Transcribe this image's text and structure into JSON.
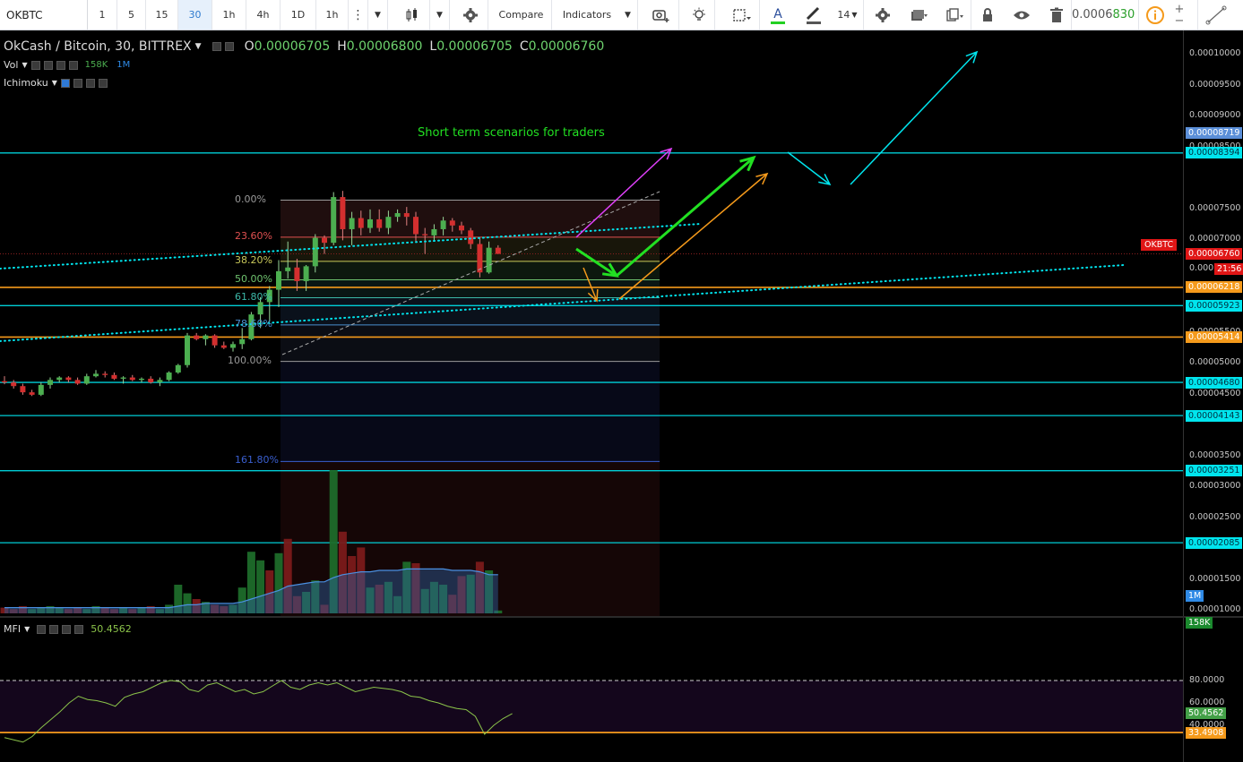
{
  "toolbar": {
    "symbol": "OKBTC",
    "intervals": [
      "1",
      "5",
      "15",
      "30",
      "1h",
      "4h",
      "1D",
      "1h"
    ],
    "active_interval": "30",
    "compare_label": "Compare",
    "indicators_label": "Indicators",
    "font_size": "14",
    "price_peek_a": "0.0006",
    "price_peek_b": "830"
  },
  "legend": {
    "title": "OkCash / Bitcoin, 30, BITTREX",
    "o_label": "O",
    "o": "0.00006705",
    "h_label": "H",
    "h": "0.00006800",
    "l_label": "L",
    "l": "0.00006705",
    "c_label": "C",
    "c": "0.00006760",
    "vol_label": "Vol",
    "vol_value": "158K",
    "vol_ma": "1M",
    "ichimoku_label": "Ichimoku",
    "mfi_label": "MFI",
    "mfi_value": "50.4562"
  },
  "annotation": {
    "text": "Short term scenarios for traders"
  },
  "fib_levels": [
    {
      "label": "0.00%",
      "color": "#9a9a9a"
    },
    {
      "label": "23.60%",
      "color": "#e05050"
    },
    {
      "label": "38.20%",
      "color": "#c9c95a"
    },
    {
      "label": "50.00%",
      "color": "#6fc36f"
    },
    {
      "label": "61.80%",
      "color": "#3cb8a8"
    },
    {
      "label": "78.60%",
      "color": "#4a8fd0"
    },
    {
      "label": "100.00%",
      "color": "#9a9a9a"
    },
    {
      "label": "161.80%",
      "color": "#3a5fd0"
    }
  ],
  "price_axis": {
    "ticks": [
      "0.00010000",
      "0.00009500",
      "0.00009000",
      "0.00008500",
      "0.00007500",
      "0.00007000",
      "0.000",
      "0.00005500",
      "0.00005000",
      "0.00004500",
      "0.00003500",
      "0.00003000",
      "0.00002500",
      "0.00001500",
      "0.00001000"
    ],
    "labels": [
      {
        "text": "0.00008719",
        "bg": "#5b8fd8",
        "fg": "#ffffff"
      },
      {
        "text": "0.00008394",
        "bg": "#00e5ee",
        "fg": "#003040"
      },
      {
        "text": "0.00006760",
        "bg": "#e01616",
        "fg": "#ffffff"
      },
      {
        "text": "21:56",
        "bg": "#e01616",
        "fg": "#ffffff"
      },
      {
        "text": "0.00006218",
        "bg": "#f59a1b",
        "fg": "#ffffff"
      },
      {
        "text": "0.00005923",
        "bg": "#00e5ee",
        "fg": "#003040"
      },
      {
        "text": "0.00005414",
        "bg": "#f59a1b",
        "fg": "#ffffff"
      },
      {
        "text": "0.00004680",
        "bg": "#00e5ee",
        "fg": "#003040"
      },
      {
        "text": "0.00004143",
        "bg": "#00e5ee",
        "fg": "#003040"
      },
      {
        "text": "0.00003251",
        "bg": "#00e5ee",
        "fg": "#003040"
      },
      {
        "text": "0.00002085",
        "bg": "#00e5ee",
        "fg": "#003040"
      },
      {
        "text": "1M",
        "bg": "#2f8ae6",
        "fg": "#ffffff"
      },
      {
        "text": "158K",
        "bg": "#1b8a2e",
        "fg": "#ffffff"
      }
    ],
    "symbol_badge": "OKBTC"
  },
  "mfi_axis": {
    "ticks": [
      "80.0000",
      "60.0000",
      "40.0000"
    ],
    "labels": [
      {
        "text": "50.4562",
        "bg": "#43a047",
        "fg": "#ffffff"
      },
      {
        "text": "33.4908",
        "bg": "#f59a1b",
        "fg": "#ffffff"
      }
    ]
  },
  "colors": {
    "up": "#4caf50",
    "down": "#d32f2f",
    "cyan": "#00e5ee",
    "orange": "#f59a1b",
    "magenta": "#e040fb",
    "green_arrow": "#22e022",
    "mfi_bg": "#14061c"
  },
  "candles": [
    [
      4.7e-05,
      4.78e-05,
      4.65e-05,
      4.68e-05
    ],
    [
      4.68e-05,
      4.72e-05,
      4.58e-05,
      4.62e-05
    ],
    [
      4.62e-05,
      4.66e-05,
      4.48e-05,
      4.52e-05
    ],
    [
      4.52e-05,
      4.56e-05,
      4.46e-05,
      4.48e-05
    ],
    [
      4.48e-05,
      4.68e-05,
      4.46e-05,
      4.64e-05
    ],
    [
      4.64e-05,
      4.76e-05,
      4.58e-05,
      4.72e-05
    ],
    [
      4.72e-05,
      4.78e-05,
      4.68e-05,
      4.76e-05
    ],
    [
      4.76e-05,
      4.78e-05,
      4.68e-05,
      4.72e-05
    ],
    [
      4.72e-05,
      4.76e-05,
      4.64e-05,
      4.66e-05
    ],
    [
      4.66e-05,
      4.82e-05,
      4.64e-05,
      4.78e-05
    ],
    [
      4.78e-05,
      4.88e-05,
      4.76e-05,
      4.82e-05
    ],
    [
      4.82e-05,
      4.86e-05,
      4.76e-05,
      4.8e-05
    ],
    [
      4.8e-05,
      4.84e-05,
      4.72e-05,
      4.74e-05
    ],
    [
      4.74e-05,
      4.78e-05,
      4.66e-05,
      4.76e-05
    ],
    [
      4.76e-05,
      4.8e-05,
      4.7e-05,
      4.72e-05
    ],
    [
      4.72e-05,
      4.76e-05,
      4.68e-05,
      4.74e-05
    ],
    [
      4.74e-05,
      4.78e-05,
      4.66e-05,
      4.68e-05
    ],
    [
      4.68e-05,
      4.76e-05,
      4.62e-05,
      4.72e-05
    ],
    [
      4.72e-05,
      4.86e-05,
      4.7e-05,
      4.84e-05
    ],
    [
      4.84e-05,
      4.98e-05,
      4.82e-05,
      4.96e-05
    ],
    [
      4.96e-05,
      5.48e-05,
      4.92e-05,
      5.44e-05
    ],
    [
      5.44e-05,
      5.48e-05,
      5.36e-05,
      5.38e-05
    ],
    [
      5.38e-05,
      5.46e-05,
      5.28e-05,
      5.44e-05
    ],
    [
      5.44e-05,
      5.46e-05,
      5.24e-05,
      5.28e-05
    ],
    [
      5.28e-05,
      5.34e-05,
      5.22e-05,
      5.24e-05
    ],
    [
      5.24e-05,
      5.34e-05,
      5.18e-05,
      5.3e-05
    ],
    [
      5.3e-05,
      5.56e-05,
      5.22e-05,
      5.38e-05
    ],
    [
      5.38e-05,
      5.82e-05,
      5.36e-05,
      5.78e-05
    ],
    [
      5.78e-05,
      6.06e-05,
      5.56e-05,
      5.98e-05
    ],
    [
      5.98e-05,
      6.24e-05,
      5.66e-05,
      6.18e-05
    ],
    [
      6.18e-05,
      6.66e-05,
      5.9e-05,
      6.48e-05
    ],
    [
      6.48e-05,
      6.96e-05,
      6.36e-05,
      6.54e-05
    ],
    [
      6.54e-05,
      6.68e-05,
      6.16e-05,
      6.32e-05
    ],
    [
      6.32e-05,
      6.58e-05,
      6.16e-05,
      6.56e-05
    ],
    [
      6.56e-05,
      7.08e-05,
      6.46e-05,
      7.02e-05
    ],
    [
      7.02e-05,
      7.06e-05,
      6.76e-05,
      6.94e-05
    ],
    [
      6.94e-05,
      7.76e-05,
      6.9e-05,
      7.68e-05
    ],
    [
      7.68e-05,
      7.78e-05,
      6.98e-05,
      7.16e-05
    ],
    [
      7.16e-05,
      7.44e-05,
      6.9e-05,
      7.34e-05
    ],
    [
      7.34e-05,
      7.46e-05,
      7.06e-05,
      7.18e-05
    ],
    [
      7.18e-05,
      7.48e-05,
      7.1e-05,
      7.32e-05
    ],
    [
      7.32e-05,
      7.48e-05,
      7.12e-05,
      7.18e-05
    ],
    [
      7.18e-05,
      7.46e-05,
      7.08e-05,
      7.36e-05
    ],
    [
      7.36e-05,
      7.48e-05,
      7.28e-05,
      7.42e-05
    ],
    [
      7.42e-05,
      7.52e-05,
      7.22e-05,
      7.36e-05
    ],
    [
      7.36e-05,
      7.44e-05,
      6.96e-05,
      7.08e-05
    ],
    [
      7.08e-05,
      7.18e-05,
      6.76e-05,
      7.06e-05
    ],
    [
      7.06e-05,
      7.24e-05,
      6.96e-05,
      7.16e-05
    ],
    [
      7.16e-05,
      7.36e-05,
      7.06e-05,
      7.3e-05
    ],
    [
      7.3e-05,
      7.34e-05,
      7.12e-05,
      7.22e-05
    ],
    [
      7.22e-05,
      7.28e-05,
      7.08e-05,
      7.14e-05
    ],
    [
      7.14e-05,
      7.18e-05,
      6.84e-05,
      6.92e-05
    ],
    [
      6.92e-05,
      7.02e-05,
      6.38e-05,
      6.46e-05
    ],
    [
      6.46e-05,
      6.96e-05,
      6.44e-05,
      6.86e-05
    ],
    [
      6.86e-05,
      6.9e-05,
      6.76e-05,
      6.76e-05
    ]
  ],
  "volume": [
    {
      "v": 0.04,
      "up": false
    },
    {
      "v": 0.03,
      "up": false
    },
    {
      "v": 0.05,
      "up": false
    },
    {
      "v": 0.03,
      "up": true
    },
    {
      "v": 0.04,
      "up": true
    },
    {
      "v": 0.05,
      "up": true
    },
    {
      "v": 0.04,
      "up": true
    },
    {
      "v": 0.03,
      "up": false
    },
    {
      "v": 0.04,
      "up": false
    },
    {
      "v": 0.03,
      "up": true
    },
    {
      "v": 0.05,
      "up": true
    },
    {
      "v": 0.04,
      "up": false
    },
    {
      "v": 0.03,
      "up": false
    },
    {
      "v": 0.04,
      "up": true
    },
    {
      "v": 0.03,
      "up": false
    },
    {
      "v": 0.04,
      "up": true
    },
    {
      "v": 0.05,
      "up": false
    },
    {
      "v": 0.03,
      "up": true
    },
    {
      "v": 0.06,
      "up": true
    },
    {
      "v": 0.2,
      "up": true
    },
    {
      "v": 0.14,
      "up": true
    },
    {
      "v": 0.1,
      "up": false
    },
    {
      "v": 0.08,
      "up": true
    },
    {
      "v": 0.06,
      "up": false
    },
    {
      "v": 0.05,
      "up": false
    },
    {
      "v": 0.06,
      "up": true
    },
    {
      "v": 0.18,
      "up": true
    },
    {
      "v": 0.43,
      "up": true
    },
    {
      "v": 0.37,
      "up": true
    },
    {
      "v": 0.3,
      "up": false
    },
    {
      "v": 0.42,
      "up": true
    },
    {
      "v": 0.52,
      "up": false
    },
    {
      "v": 0.12,
      "up": false
    },
    {
      "v": 0.15,
      "up": true
    },
    {
      "v": 0.23,
      "up": true
    },
    {
      "v": 0.06,
      "up": false
    },
    {
      "v": 1.0,
      "up": true
    },
    {
      "v": 0.57,
      "up": false
    },
    {
      "v": 0.4,
      "up": false
    },
    {
      "v": 0.46,
      "up": false
    },
    {
      "v": 0.18,
      "up": true
    },
    {
      "v": 0.2,
      "up": false
    },
    {
      "v": 0.22,
      "up": true
    },
    {
      "v": 0.12,
      "up": true
    },
    {
      "v": 0.36,
      "up": true
    },
    {
      "v": 0.35,
      "up": false
    },
    {
      "v": 0.17,
      "up": true
    },
    {
      "v": 0.22,
      "up": true
    },
    {
      "v": 0.2,
      "up": true
    },
    {
      "v": 0.13,
      "up": false
    },
    {
      "v": 0.26,
      "up": false
    },
    {
      "v": 0.27,
      "up": true
    },
    {
      "v": 0.36,
      "up": false
    },
    {
      "v": 0.3,
      "up": true
    },
    {
      "v": 0.02,
      "up": true
    }
  ],
  "mfi_series": [
    29,
    27,
    25,
    30,
    38,
    45,
    52,
    60,
    66,
    63,
    62,
    60,
    57,
    65,
    68,
    70,
    74,
    78,
    80,
    79,
    72,
    70,
    76,
    78,
    74,
    70,
    72,
    68,
    70,
    75,
    80,
    74,
    72,
    76,
    78,
    76,
    78,
    74,
    70,
    72,
    74,
    73,
    72,
    70,
    66,
    65,
    62,
    60,
    57,
    55,
    54,
    48,
    32,
    40,
    46,
    50.4562
  ],
  "mfi_levels": {
    "upper": 80,
    "lower": 33.4908
  }
}
